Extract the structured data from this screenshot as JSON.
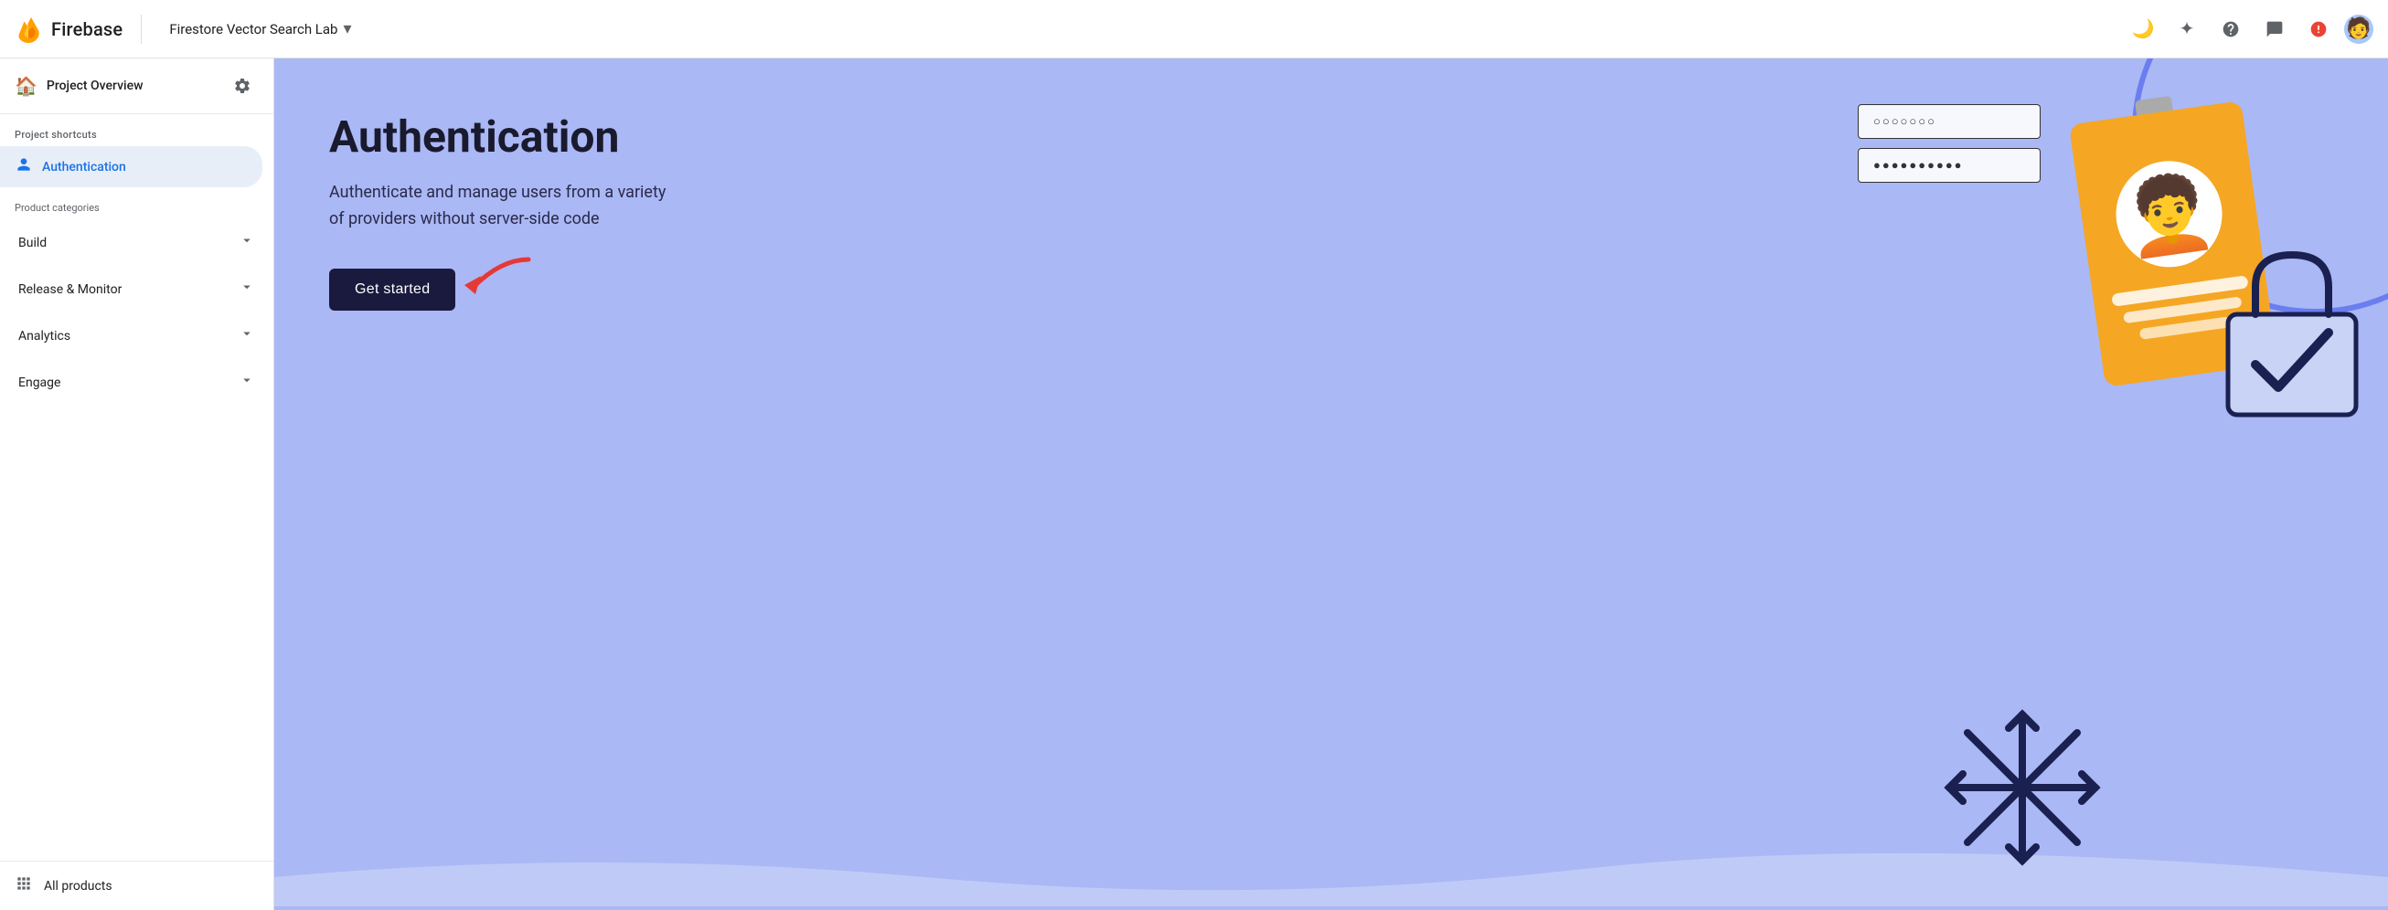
{
  "header": {
    "firebase_label": "Firebase",
    "project_name": "Firestore Vector Search Lab",
    "project_overview_label": "Project Overview",
    "icons": {
      "dark_mode": "🌙",
      "spark": "✦",
      "help": "?",
      "chat": "💬",
      "notifications": "🔔"
    }
  },
  "sidebar": {
    "project_overview": "Project Overview",
    "project_shortcuts_label": "Project shortcuts",
    "authentication_label": "Authentication",
    "product_categories_label": "Product categories",
    "build_label": "Build",
    "release_monitor_label": "Release & Monitor",
    "analytics_label": "Analytics",
    "engage_label": "Engage",
    "all_products_label": "All products"
  },
  "main": {
    "title": "Authentication",
    "description": "Authenticate and manage users from a variety of providers without server-side code",
    "cta_label": "Get started"
  },
  "illustration": {
    "input1_text": "○○○○○○○",
    "input2_text": "●●●●●●●●●●"
  }
}
